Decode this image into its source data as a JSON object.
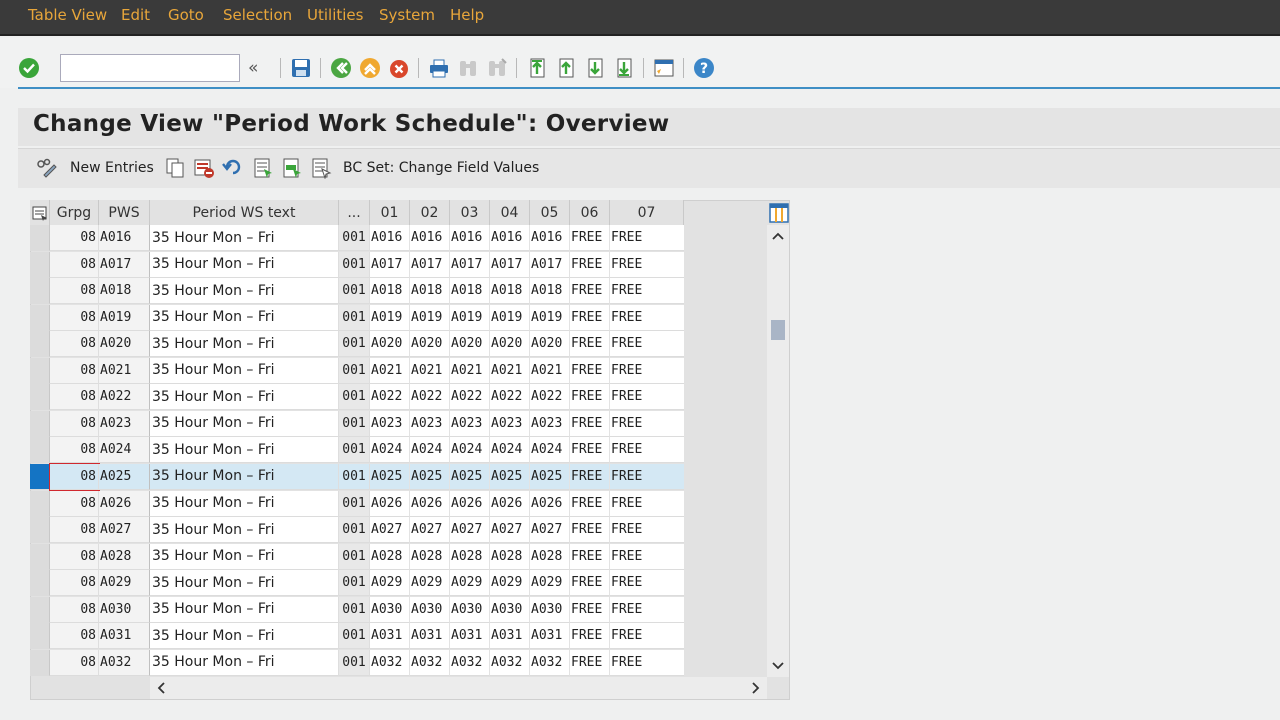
{
  "menu": [
    "Table View",
    "Edit",
    "Goto",
    "Selection",
    "Utilities",
    "System",
    "Help"
  ],
  "toolbar": {
    "command_value": "",
    "expand_label": "«"
  },
  "page_title": "Change View \"Period Work Schedule\": Overview",
  "appbar": {
    "new_entries": "New Entries",
    "bc_set": "BC Set: Change Field Values"
  },
  "table": {
    "columns": [
      "Grpg",
      "PWS",
      "Period WS text",
      "...",
      "01",
      "02",
      "03",
      "04",
      "05",
      "06",
      "07"
    ],
    "selected_row": 9,
    "rows": [
      {
        "grpg": "08",
        "pws": "A016",
        "text": "35 Hour Mon – Fri",
        "seq": "001",
        "d01": "A016",
        "d02": "A016",
        "d03": "A016",
        "d04": "A016",
        "d05": "A016",
        "d06": "FREE",
        "d07": "FREE"
      },
      {
        "grpg": "08",
        "pws": "A017",
        "text": "35 Hour Mon – Fri",
        "seq": "001",
        "d01": "A017",
        "d02": "A017",
        "d03": "A017",
        "d04": "A017",
        "d05": "A017",
        "d06": "FREE",
        "d07": "FREE"
      },
      {
        "grpg": "08",
        "pws": "A018",
        "text": "35 Hour Mon – Fri",
        "seq": "001",
        "d01": "A018",
        "d02": "A018",
        "d03": "A018",
        "d04": "A018",
        "d05": "A018",
        "d06": "FREE",
        "d07": "FREE"
      },
      {
        "grpg": "08",
        "pws": "A019",
        "text": "35 Hour Mon – Fri",
        "seq": "001",
        "d01": "A019",
        "d02": "A019",
        "d03": "A019",
        "d04": "A019",
        "d05": "A019",
        "d06": "FREE",
        "d07": "FREE"
      },
      {
        "grpg": "08",
        "pws": "A020",
        "text": "35 Hour Mon – Fri",
        "seq": "001",
        "d01": "A020",
        "d02": "A020",
        "d03": "A020",
        "d04": "A020",
        "d05": "A020",
        "d06": "FREE",
        "d07": "FREE"
      },
      {
        "grpg": "08",
        "pws": "A021",
        "text": "35 Hour Mon – Fri",
        "seq": "001",
        "d01": "A021",
        "d02": "A021",
        "d03": "A021",
        "d04": "A021",
        "d05": "A021",
        "d06": "FREE",
        "d07": "FREE"
      },
      {
        "grpg": "08",
        "pws": "A022",
        "text": "35 Hour Mon – Fri",
        "seq": "001",
        "d01": "A022",
        "d02": "A022",
        "d03": "A022",
        "d04": "A022",
        "d05": "A022",
        "d06": "FREE",
        "d07": "FREE"
      },
      {
        "grpg": "08",
        "pws": "A023",
        "text": "35 Hour Mon – Fri",
        "seq": "001",
        "d01": "A023",
        "d02": "A023",
        "d03": "A023",
        "d04": "A023",
        "d05": "A023",
        "d06": "FREE",
        "d07": "FREE"
      },
      {
        "grpg": "08",
        "pws": "A024",
        "text": "35 Hour Mon – Fri",
        "seq": "001",
        "d01": "A024",
        "d02": "A024",
        "d03": "A024",
        "d04": "A024",
        "d05": "A024",
        "d06": "FREE",
        "d07": "FREE"
      },
      {
        "grpg": "08",
        "pws": "A025",
        "text": "35 Hour Mon – Fri",
        "seq": "001",
        "d01": "A025",
        "d02": "A025",
        "d03": "A025",
        "d04": "A025",
        "d05": "A025",
        "d06": "FREE",
        "d07": "FREE"
      },
      {
        "grpg": "08",
        "pws": "A026",
        "text": "35 Hour Mon – Fri",
        "seq": "001",
        "d01": "A026",
        "d02": "A026",
        "d03": "A026",
        "d04": "A026",
        "d05": "A026",
        "d06": "FREE",
        "d07": "FREE"
      },
      {
        "grpg": "08",
        "pws": "A027",
        "text": "35 Hour Mon – Fri",
        "seq": "001",
        "d01": "A027",
        "d02": "A027",
        "d03": "A027",
        "d04": "A027",
        "d05": "A027",
        "d06": "FREE",
        "d07": "FREE"
      },
      {
        "grpg": "08",
        "pws": "A028",
        "text": "35 Hour Mon – Fri",
        "seq": "001",
        "d01": "A028",
        "d02": "A028",
        "d03": "A028",
        "d04": "A028",
        "d05": "A028",
        "d06": "FREE",
        "d07": "FREE"
      },
      {
        "grpg": "08",
        "pws": "A029",
        "text": "35 Hour Mon – Fri",
        "seq": "001",
        "d01": "A029",
        "d02": "A029",
        "d03": "A029",
        "d04": "A029",
        "d05": "A029",
        "d06": "FREE",
        "d07": "FREE"
      },
      {
        "grpg": "08",
        "pws": "A030",
        "text": "35 Hour Mon – Fri",
        "seq": "001",
        "d01": "A030",
        "d02": "A030",
        "d03": "A030",
        "d04": "A030",
        "d05": "A030",
        "d06": "FREE",
        "d07": "FREE"
      },
      {
        "grpg": "08",
        "pws": "A031",
        "text": "35 Hour Mon – Fri",
        "seq": "001",
        "d01": "A031",
        "d02": "A031",
        "d03": "A031",
        "d04": "A031",
        "d05": "A031",
        "d06": "FREE",
        "d07": "FREE"
      },
      {
        "grpg": "08",
        "pws": "A032",
        "text": "35 Hour Mon – Fri",
        "seq": "001",
        "d01": "A032",
        "d02": "A032",
        "d03": "A032",
        "d04": "A032",
        "d05": "A032",
        "d06": "FREE",
        "d07": "FREE"
      }
    ]
  },
  "icons": {
    "toolbar": [
      "enter-icon",
      "save-icon",
      "back-icon",
      "exit-icon",
      "cancel-icon",
      "print-icon",
      "find-icon",
      "find-next-icon",
      "first-page-icon",
      "previous-page-icon",
      "next-page-icon",
      "last-page-icon",
      "create-session-icon",
      "help-icon"
    ],
    "appbar": [
      "change-display-icon",
      "copy-as-icon",
      "delete-icon",
      "undo-change-icon",
      "select-all-icon",
      "select-block-icon",
      "deselect-all-icon"
    ],
    "table": [
      "table-settings-icon",
      "column-config-icon",
      "scroll-up-icon",
      "scroll-down-icon",
      "scroll-left-icon",
      "scroll-right-icon"
    ]
  },
  "colors": {
    "menubar_bg": "#3a3a3a",
    "menu_text": "#e8a63a",
    "accent_line": "#3f8fc5",
    "selected_row": "#d4e8f4",
    "row_selector": "#1474c4"
  }
}
